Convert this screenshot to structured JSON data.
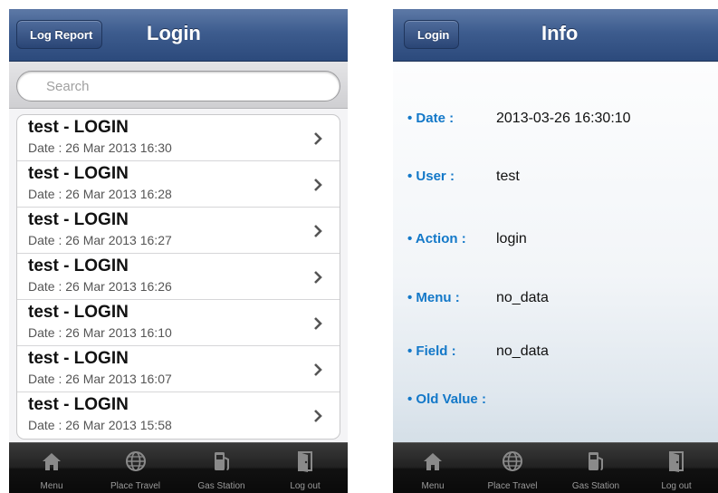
{
  "left_screen": {
    "nav": {
      "back_label": "Log Report",
      "title": "Login"
    },
    "search": {
      "placeholder": "Search"
    },
    "list": [
      {
        "title": "test - LOGIN",
        "date": "Date : 26 Mar 2013 16:30"
      },
      {
        "title": "test - LOGIN",
        "date": "Date : 26 Mar 2013 16:28"
      },
      {
        "title": "test - LOGIN",
        "date": "Date : 26 Mar 2013 16:27"
      },
      {
        "title": "test - LOGIN",
        "date": "Date : 26 Mar 2013 16:26"
      },
      {
        "title": "test - LOGIN",
        "date": "Date : 26 Mar 2013 16:10"
      },
      {
        "title": "test - LOGIN",
        "date": "Date : 26 Mar 2013 16:07"
      },
      {
        "title": "test - LOGIN",
        "date": "Date : 26 Mar 2013 15:58"
      }
    ],
    "tabs": [
      {
        "label": "Menu",
        "icon": "home-icon"
      },
      {
        "label": "Place Travel",
        "icon": "globe-icon"
      },
      {
        "label": "Gas Station",
        "icon": "gas-pump-icon"
      },
      {
        "label": "Log out",
        "icon": "door-icon"
      }
    ]
  },
  "right_screen": {
    "nav": {
      "back_label": "Login",
      "title": "Info"
    },
    "fields": [
      {
        "label": "• Date  :",
        "value": "2013-03-26 16:30:10"
      },
      {
        "label": "• User  :",
        "value": "test"
      },
      {
        "label": "• Action  :",
        "value": "login"
      },
      {
        "label": "• Menu  :",
        "value": "no_data"
      },
      {
        "label": "• Field  :",
        "value": "no_data"
      },
      {
        "label": "• Old Value  :",
        "value": ""
      }
    ],
    "tabs": [
      {
        "label": "Menu",
        "icon": "home-icon"
      },
      {
        "label": "Place Travel",
        "icon": "globe-icon"
      },
      {
        "label": "Gas Station",
        "icon": "gas-pump-icon"
      },
      {
        "label": "Log out",
        "icon": "door-icon"
      }
    ]
  },
  "colors": {
    "navbar": "#3d5c8e",
    "label_blue": "#1378c8",
    "tabbar": "#1a1a1a"
  }
}
